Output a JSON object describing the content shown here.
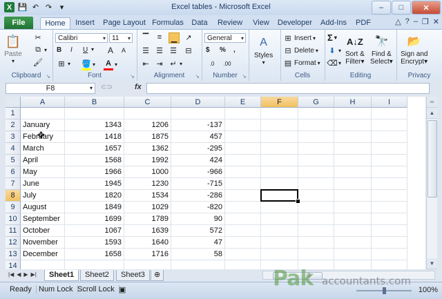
{
  "window": {
    "title": "Excel tables - Microsoft Excel",
    "min": "–",
    "max": "□",
    "close": "✕"
  },
  "tabs": [
    "File",
    "Home",
    "Insert",
    "Page Layout",
    "Formulas",
    "Data",
    "Review",
    "View",
    "Developer",
    "Add-Ins",
    "PDF"
  ],
  "active_tab": "Home",
  "ribbon": {
    "clipboard": {
      "label": "Clipboard",
      "paste": "Paste"
    },
    "font": {
      "label": "Font",
      "name": "Calibri",
      "size": "11",
      "bold": "B",
      "italic": "I",
      "underline": "U",
      "grow": "A",
      "shrink": "A"
    },
    "alignment": {
      "label": "Alignment"
    },
    "number": {
      "label": "Number",
      "format": "General",
      "currency": "$",
      "percent": "%",
      "comma": ","
    },
    "styles": {
      "label": "Styles"
    },
    "cells": {
      "label": "Cells",
      "insert": "Insert",
      "delete": "Delete",
      "format": "Format"
    },
    "editing": {
      "label": "Editing",
      "sigma": "Σ",
      "sort": "Sort &",
      "sort2": "Filter",
      "find": "Find &",
      "find2": "Select"
    },
    "privacy": {
      "label": "Privacy",
      "sign": "Sign and",
      "sign2": "Encrypt"
    }
  },
  "formula_bar": {
    "name_box": "F8",
    "fx": "fx",
    "value": ""
  },
  "columns": [
    "A",
    "B",
    "C",
    "D",
    "E",
    "F",
    "G",
    "H",
    "I"
  ],
  "selected_column": "F",
  "selected_row": 8,
  "rows": [
    {
      "n": "1",
      "a": "",
      "b": "",
      "c": "",
      "d": ""
    },
    {
      "n": "2",
      "a": "January",
      "b": "1343",
      "c": "1206",
      "d": "-137"
    },
    {
      "n": "3",
      "a": "February",
      "b": "1418",
      "c": "1875",
      "d": "457"
    },
    {
      "n": "4",
      "a": "March",
      "b": "1657",
      "c": "1362",
      "d": "-295"
    },
    {
      "n": "5",
      "a": "April",
      "b": "1568",
      "c": "1992",
      "d": "424"
    },
    {
      "n": "6",
      "a": "May",
      "b": "1966",
      "c": "1000",
      "d": "-966"
    },
    {
      "n": "7",
      "a": "June",
      "b": "1945",
      "c": "1230",
      "d": "-715"
    },
    {
      "n": "8",
      "a": "July",
      "b": "1820",
      "c": "1534",
      "d": "-286"
    },
    {
      "n": "9",
      "a": "August",
      "b": "1849",
      "c": "1029",
      "d": "-820"
    },
    {
      "n": "10",
      "a": "September",
      "b": "1699",
      "c": "1789",
      "d": "90"
    },
    {
      "n": "11",
      "a": "October",
      "b": "1067",
      "c": "1639",
      "d": "572"
    },
    {
      "n": "12",
      "a": "November",
      "b": "1593",
      "c": "1640",
      "d": "47"
    },
    {
      "n": "13",
      "a": "December",
      "b": "1658",
      "c": "1716",
      "d": "58"
    },
    {
      "n": "14",
      "a": "",
      "b": "",
      "c": "",
      "d": ""
    }
  ],
  "sheets": [
    "Sheet1",
    "Sheet2",
    "Sheet3"
  ],
  "active_sheet": "Sheet1",
  "status": {
    "ready": "Ready",
    "numlock": "Num Lock",
    "scrolllock": "Scroll Lock",
    "zoom": "100%"
  },
  "watermark": {
    "brand": "Pak",
    "site": "accountants.com"
  }
}
